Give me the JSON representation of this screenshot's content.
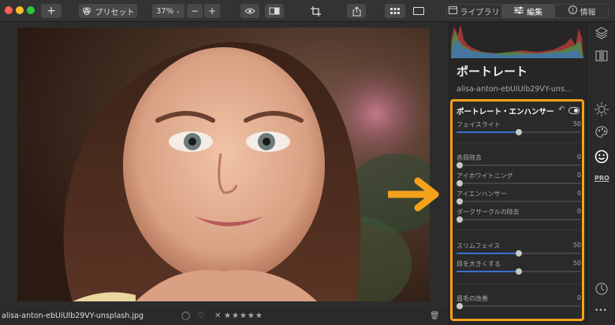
{
  "toolbar": {
    "preset_label": "プリセット",
    "zoom_label": "37%",
    "zoom_minus": "−",
    "zoom_plus": "+",
    "add_label": "+",
    "tabs": [
      {
        "label": "ライブラリ",
        "icon": "library-icon"
      },
      {
        "label": "編集",
        "icon": "sliders-icon"
      },
      {
        "label": "情報",
        "icon": "info-icon"
      }
    ]
  },
  "bottombar": {
    "filename": "alisa-anton-ebUiUlb29VY-unsplash.jpg",
    "stars": "★★★★★",
    "reject": "✕",
    "circle": "◯",
    "heart": "♡",
    "trash": "🗑"
  },
  "panel": {
    "title": "ポートレート",
    "subtitle": "alisa-anton-ebUiUlb29VY-uns...",
    "enhancer": {
      "title": "ポートレート・エンハンサー",
      "undo": "↶",
      "toggle_on": true,
      "sliders": [
        {
          "label": "フェイスライト",
          "value": "50",
          "fraction": 0.5
        },
        {
          "label": "赤目除去",
          "value": "0",
          "fraction": 0.0
        },
        {
          "label": "アイホワイトニング",
          "value": "0",
          "fraction": 0.0
        },
        {
          "label": "アイエンハンサー",
          "value": "0",
          "fraction": 0.0
        },
        {
          "label": "ダークサークルの除去",
          "value": "0",
          "fraction": 0.0
        },
        {
          "label": "スリムフェイス",
          "value": "50",
          "fraction": 0.5
        },
        {
          "label": "目を大きくする",
          "value": "50",
          "fraction": 0.5
        },
        {
          "label": "眉毛の改善",
          "value": "0",
          "fraction": 0.0
        }
      ]
    }
  },
  "colors": {
    "accent_orange": "#f5a11a",
    "slider_blue": "#3a6fd8"
  },
  "rail_icons": [
    "layers-icon",
    "compare-icon",
    "sun-icon",
    "palette-icon",
    "face-icon",
    "pro-icon",
    "clock-icon",
    "more-icon"
  ],
  "rail_pro": "PRO",
  "rail_more": "•••"
}
